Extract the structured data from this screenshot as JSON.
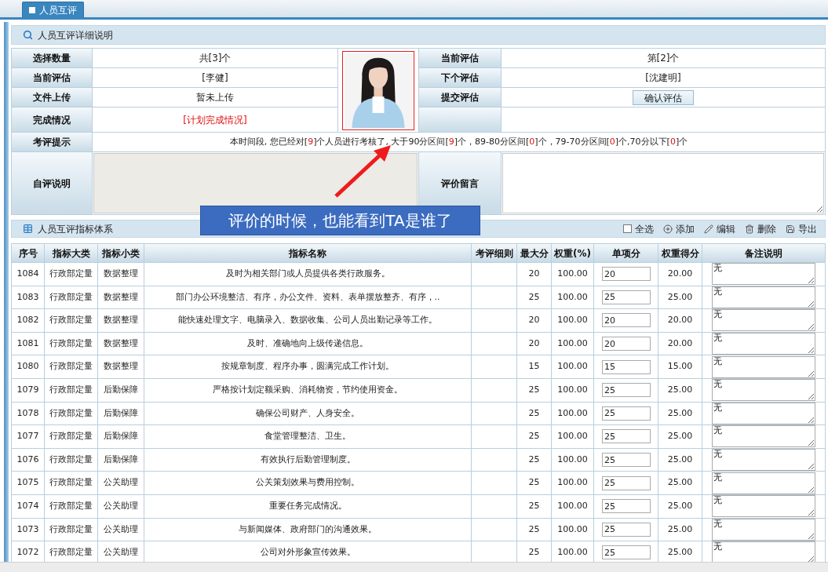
{
  "tab": {
    "label": "人员互评",
    "selected": true
  },
  "detail_panel": {
    "title": "人员互评详细说明"
  },
  "info_rows": [
    {
      "label": "选择数量",
      "value": "共[3]个",
      "kind": "text",
      "right": {
        "kind": "text",
        "label": "当前评估",
        "value": "第[2]个"
      }
    },
    {
      "label": "当前评估",
      "value": "[李健]",
      "kind": "text",
      "right": {
        "kind": "text",
        "label": "下个评估",
        "value": "[沈建明]"
      }
    },
    {
      "label": "文件上传",
      "value": "暂未上传",
      "kind": "text",
      "right": {
        "kind": "button",
        "label": "提交评估",
        "value": "确认评估"
      }
    },
    {
      "label": "完成情况",
      "value": "[计划完成情况]",
      "kind": "link"
    }
  ],
  "hint": {
    "label": "考评提示",
    "segments": [
      {
        "text": "本时间段, 您已经对[",
        "highlight": false
      },
      {
        "text": "9",
        "highlight": true
      },
      {
        "text": "]个人员进行考核了, 大于90分区间[",
        "highlight": false
      },
      {
        "text": "9",
        "highlight": true
      },
      {
        "text": "]个，89-80分区间[",
        "highlight": false
      },
      {
        "text": "0",
        "highlight": true
      },
      {
        "text": "]个，79-70分区间[",
        "highlight": false
      },
      {
        "text": "0",
        "highlight": true
      },
      {
        "text": "]个,70分以下[",
        "highlight": false
      },
      {
        "text": "0",
        "highlight": true
      },
      {
        "text": "]个",
        "highlight": false
      }
    ]
  },
  "comments": {
    "self_label": "自评说明",
    "self_disabled": true,
    "review_label": "评价留言"
  },
  "callout": {
    "text": "评价的时候，也能看到TA是谁了"
  },
  "indicator_panel": {
    "title": "人员互评指标体系",
    "toolbar": [
      {
        "kind": "checkbox",
        "label": "全选",
        "checked": false
      },
      {
        "kind": "add",
        "label": "添加"
      },
      {
        "kind": "edit",
        "label": "编辑"
      },
      {
        "kind": "delete",
        "label": "删除"
      },
      {
        "kind": "export",
        "label": "导出"
      }
    ]
  },
  "table": {
    "columns": [
      "序号",
      "指标大类",
      "指标小类",
      "指标名称",
      "考评细则",
      "最大分",
      "权重(%)",
      "单项分",
      "权重得分",
      "备注说明"
    ],
    "rows": [
      {
        "no": "1084",
        "category": "行政部定量",
        "subcategory": "数据整理",
        "name": "及时为相关部门或人员提供各类行政服务。",
        "max": "20",
        "weight": "100.00",
        "score": "20",
        "weighted": "20.00",
        "remark": "无"
      },
      {
        "no": "1083",
        "category": "行政部定量",
        "subcategory": "数据整理",
        "name": "部门办公环境整洁、有序，办公文件、资料、表单摆放整齐、有序，..",
        "max": "25",
        "weight": "100.00",
        "score": "25",
        "weighted": "25.00",
        "remark": "无"
      },
      {
        "no": "1082",
        "category": "行政部定量",
        "subcategory": "数据整理",
        "name": "能快速处理文字、电脑录入、数据收集、公司人员出勤记录等工作。",
        "max": "20",
        "weight": "100.00",
        "score": "20",
        "weighted": "20.00",
        "remark": "无"
      },
      {
        "no": "1081",
        "category": "行政部定量",
        "subcategory": "数据整理",
        "name": "及时、准确地向上级传递信息。",
        "max": "20",
        "weight": "100.00",
        "score": "20",
        "weighted": "20.00",
        "remark": "无"
      },
      {
        "no": "1080",
        "category": "行政部定量",
        "subcategory": "数据整理",
        "name": "按规章制度、程序办事，圆满完成工作计划。",
        "max": "15",
        "weight": "100.00",
        "score": "15",
        "weighted": "15.00",
        "remark": "无"
      },
      {
        "no": "1079",
        "category": "行政部定量",
        "subcategory": "后勤保障",
        "name": "严格按计划定额采购、消耗物资，节约使用资金。",
        "max": "25",
        "weight": "100.00",
        "score": "25",
        "weighted": "25.00",
        "remark": "无"
      },
      {
        "no": "1078",
        "category": "行政部定量",
        "subcategory": "后勤保障",
        "name": "确保公司财产、人身安全。",
        "max": "25",
        "weight": "100.00",
        "score": "25",
        "weighted": "25.00",
        "remark": "无"
      },
      {
        "no": "1077",
        "category": "行政部定量",
        "subcategory": "后勤保障",
        "name": "食堂管理整洁、卫生。",
        "max": "25",
        "weight": "100.00",
        "score": "25",
        "weighted": "25.00",
        "remark": "无"
      },
      {
        "no": "1076",
        "category": "行政部定量",
        "subcategory": "后勤保障",
        "name": "有效执行后勤管理制度。",
        "max": "25",
        "weight": "100.00",
        "score": "25",
        "weighted": "25.00",
        "remark": "无"
      },
      {
        "no": "1075",
        "category": "行政部定量",
        "subcategory": "公关助理",
        "name": "公关策划效果与费用控制。",
        "max": "25",
        "weight": "100.00",
        "score": "25",
        "weighted": "25.00",
        "remark": "无"
      },
      {
        "no": "1074",
        "category": "行政部定量",
        "subcategory": "公关助理",
        "name": "重要任务完成情况。",
        "max": "25",
        "weight": "100.00",
        "score": "25",
        "weighted": "25.00",
        "remark": "无"
      },
      {
        "no": "1073",
        "category": "行政部定量",
        "subcategory": "公关助理",
        "name": "与新闻媒体、政府部门的沟通效果。",
        "max": "25",
        "weight": "100.00",
        "score": "25",
        "weighted": "25.00",
        "remark": "无"
      },
      {
        "no": "1072",
        "category": "行政部定量",
        "subcategory": "公关助理",
        "name": "公司对外形象宣传效果。",
        "max": "25",
        "weight": "100.00",
        "score": "25",
        "weighted": "25.00",
        "remark": "无"
      }
    ]
  }
}
